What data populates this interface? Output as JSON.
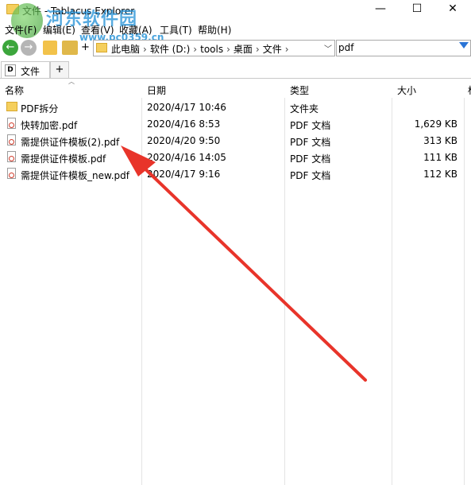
{
  "window": {
    "title": "文件 - Tablacus Explorer",
    "minimize": "—",
    "maximize": "☐",
    "close": "✕"
  },
  "menu": [
    {
      "label": "文件(F)"
    },
    {
      "label": "编辑(E)"
    },
    {
      "label": "查看(V)"
    },
    {
      "label": "收藏(A)"
    },
    {
      "label": "工具(T)"
    },
    {
      "label": "帮助(H)"
    }
  ],
  "watermark": {
    "main": "河东软件园",
    "url": "www.pc0359.cn"
  },
  "toolbar": {
    "back": "←",
    "forward": "→",
    "plus": "+"
  },
  "address": {
    "crumbs": [
      "此电脑",
      "软件 (D:)",
      "tools",
      "桌面",
      "文件"
    ],
    "separator": "›",
    "dropdown": "﹀"
  },
  "search": {
    "value": "pdf",
    "icon": "filter-icon"
  },
  "tabs": {
    "items": [
      {
        "label": "文件",
        "icon_letter": "D"
      }
    ],
    "add": "+"
  },
  "columns": {
    "name": "名称",
    "date": "日期",
    "type": "类型",
    "size": "大小",
    "extra": "标"
  },
  "files": [
    {
      "name": "PDF拆分",
      "date": "2020/4/17 10:46",
      "type": "文件夹",
      "size": "",
      "icon": "folder-icon"
    },
    {
      "name": "快转加密.pdf",
      "date": "2020/4/16 8:53",
      "type": "PDF 文档",
      "size": "1,629 KB",
      "icon": "pdf-file-icon"
    },
    {
      "name": "需提供证件模板(2).pdf",
      "date": "2020/4/20 9:50",
      "type": "PDF 文档",
      "size": "313 KB",
      "icon": "pdf-file-icon"
    },
    {
      "name": "需提供证件模板.pdf",
      "date": "2020/4/16 14:05",
      "type": "PDF 文档",
      "size": "111 KB",
      "icon": "pdf-file-icon"
    },
    {
      "name": "需提供证件模板_new.pdf",
      "date": "2020/4/17 9:16",
      "type": "PDF 文档",
      "size": "112 KB",
      "icon": "pdf-file-icon"
    }
  ],
  "annotation": {
    "arrow_color": "#e8342a"
  }
}
